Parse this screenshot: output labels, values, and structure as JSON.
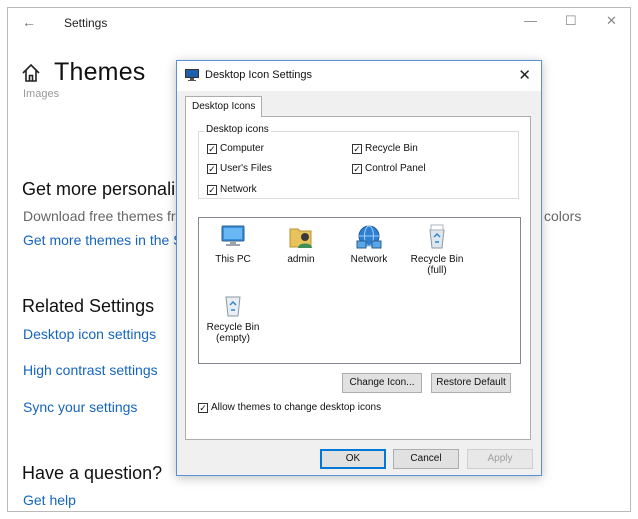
{
  "settings_window": {
    "title": "Settings",
    "back_glyph": "←",
    "minimize_glyph": "—",
    "maximize_glyph": "☐",
    "close_glyph": "✕",
    "page_title": "Themes",
    "faded_text": "Images",
    "get_more_heading": "Get more personali",
    "download_text": "Download free themes fro",
    "colors_text": "colors",
    "get_more_link": "Get more themes in the S",
    "related_heading": "Related Settings",
    "related_links": [
      "Desktop icon settings",
      "High contrast settings",
      "Sync your settings"
    ],
    "question_heading": "Have a question?",
    "help_link": "Get help"
  },
  "dialog": {
    "title": "Desktop Icon Settings",
    "close_glyph": "✕",
    "tab_label": "Desktop Icons",
    "group_label": "Desktop icons",
    "checkboxes": [
      {
        "label": "Computer",
        "checked": true
      },
      {
        "label": "User's Files",
        "checked": true
      },
      {
        "label": "Network",
        "checked": true
      },
      {
        "label": "Recycle Bin",
        "checked": true
      },
      {
        "label": "Control Panel",
        "checked": true
      }
    ],
    "icons": [
      {
        "line1": "This PC",
        "line2": "",
        "icon": "monitor-icon"
      },
      {
        "line1": "admin",
        "line2": "",
        "icon": "user-folder-icon"
      },
      {
        "line1": "Network",
        "line2": "",
        "icon": "network-icon"
      },
      {
        "line1": "Recycle Bin",
        "line2": "(full)",
        "icon": "recycle-bin-full-icon"
      },
      {
        "line1": "Recycle Bin",
        "line2": "(empty)",
        "icon": "recycle-bin-empty-icon"
      }
    ],
    "change_icon_label": "Change Icon...",
    "restore_default_label": "Restore Default",
    "allow_themes_label": "Allow themes to change desktop icons",
    "allow_themes_checked": true,
    "ok_label": "OK",
    "cancel_label": "Cancel",
    "apply_label": "Apply",
    "check_glyph": "✓",
    "colors": {
      "accent": "#0078d7",
      "link": "#1565c0"
    }
  }
}
